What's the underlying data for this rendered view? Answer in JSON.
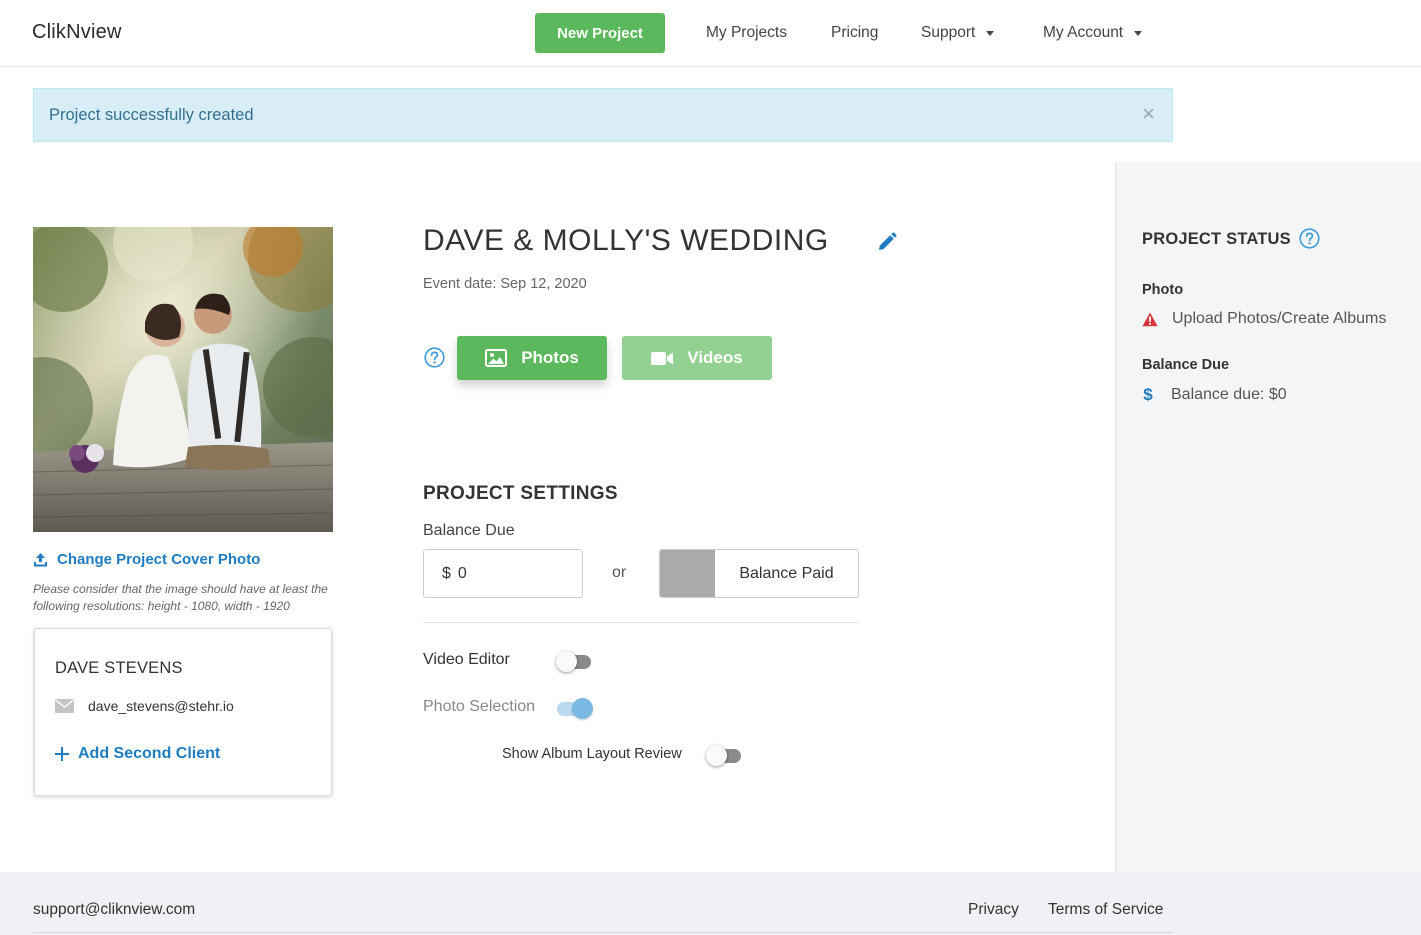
{
  "header": {
    "brand": "ClikNview",
    "new_project_label": "New Project",
    "nav": {
      "my_projects": "My Projects",
      "pricing": "Pricing",
      "support": "Support",
      "my_account": "My Account"
    }
  },
  "alert": {
    "message": "Project successfully created",
    "close_glyph": "×"
  },
  "project": {
    "title": "DAVE & MOLLY'S WEDDING",
    "event_date": "Event date: Sep 12, 2020",
    "photos_label": "Photos",
    "videos_label": "Videos"
  },
  "cover": {
    "change_label": "Change Project Cover Photo",
    "note": "Please consider that the image should have at least the following resolutions: height - 1080, width - 1920"
  },
  "client": {
    "name": "DAVE STEVENS",
    "email": "dave_stevens@stehr.io",
    "add_second_label": "Add Second Client"
  },
  "settings": {
    "title": "PROJECT SETTINGS",
    "balance_due_label": "Balance Due",
    "currency_symbol": "$",
    "balance_value": "0",
    "or_label": "or",
    "balance_paid_label": "Balance Paid",
    "balance_paid_checked": false,
    "video_editor_label": "Video Editor",
    "video_editor_on": false,
    "photo_selection_label": "Photo Selection",
    "photo_selection_on": true,
    "album_review_label": "Show Album Layout Review",
    "album_review_on": false
  },
  "status": {
    "title": "PROJECT STATUS",
    "photo_label": "Photo",
    "photo_status": "Upload Photos/Create Albums",
    "balance_label": "Balance Due",
    "balance_status": "Balance due: $0"
  },
  "footer": {
    "email": "support@cliknview.com",
    "privacy": "Privacy",
    "terms": "Terms of Service"
  },
  "colors": {
    "primary_green": "#5cb85c",
    "disabled_green": "#92d192",
    "link_blue": "#1f7cc1",
    "alert_bg": "#d9edf7",
    "alert_text": "#31708f",
    "warning_red": "#d9363e"
  },
  "icons": {
    "edit": "pencil-icon",
    "help": "question-circle-icon",
    "photos": "image-icon",
    "videos": "video-camera-icon",
    "upload": "upload-icon",
    "email": "envelope-icon",
    "add": "plus-icon",
    "warning": "warning-triangle-icon",
    "dollar": "dollar-icon"
  }
}
